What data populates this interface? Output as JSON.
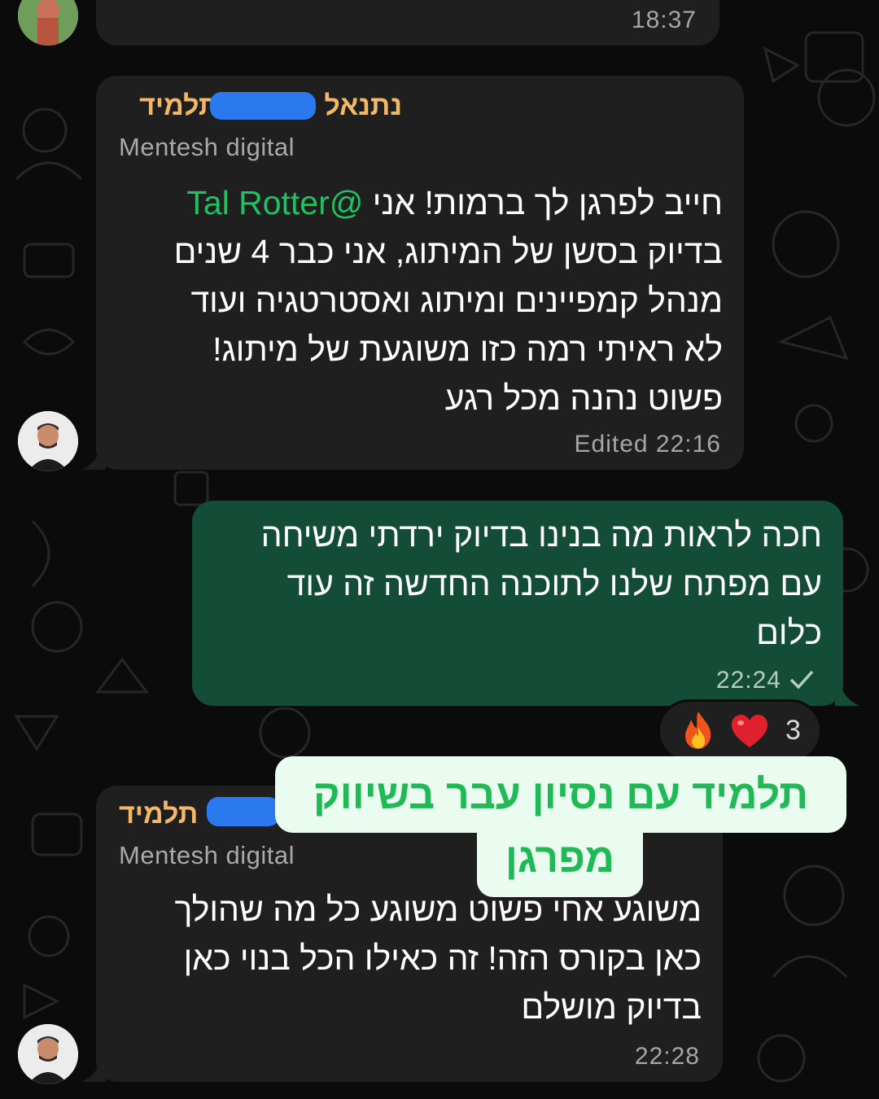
{
  "top_message": {
    "time": "18:37"
  },
  "message_1": {
    "sender": "נתנאל",
    "sender_tag": "תלמיד",
    "subtitle": "Mentesh digital",
    "mention": "@Tal Rotter",
    "lines": [
      "חייב לפרגן לך ברמות! אני",
      "בדיוק בסשן של המיתוג, אני כבר 4 שנים",
      "מנהל קמפיינים ומיתוג ואסטרטגיה ועוד",
      "לא ראיתי רמה כזו משוגעת של מיתוג!",
      "פשוט נהנה מכל רגע"
    ],
    "edited_label": "Edited",
    "time": "22:16"
  },
  "message_2": {
    "lines": [
      "חכה לראות מה בנינו בדיוק ירדתי משיחה",
      "עם מפתח שלנו לתוכנה החדשה זה עוד",
      "כלום"
    ],
    "time": "22:24",
    "read_status": "check-icon",
    "reactions": {
      "emojis": [
        "fire-icon",
        "heart-icon"
      ],
      "count": "3"
    }
  },
  "message_3": {
    "sender_tag": "תלמיד",
    "subtitle": "Mentesh digital",
    "lines": [
      "משוגע אחי פשוט משוגע כל מה שהולך",
      "כאן בקורס הזה! זה כאילו הכל בנוי כאן",
      "בדיוק מושלם"
    ],
    "time": "22:28"
  },
  "callout": {
    "line1": "תלמיד עם נסיון עבר בשיווק",
    "line2": "מפרגן"
  },
  "colors": {
    "incoming_bubble": "#1f1f1f",
    "outgoing_bubble": "#144d37",
    "sender_name": "#f4b766",
    "mention": "#21c063",
    "callout_bg": "#e9fcef",
    "callout_text": "#1fb955"
  }
}
